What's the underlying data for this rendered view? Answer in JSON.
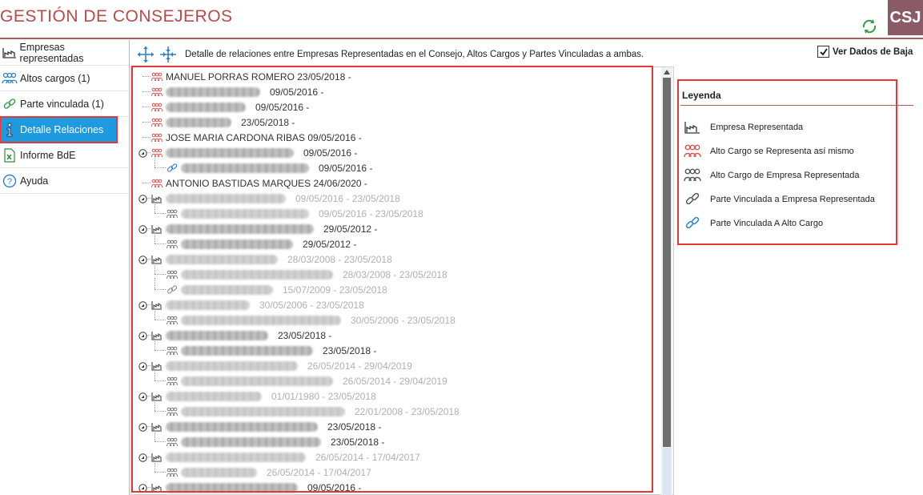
{
  "app": {
    "title": "GESTIÓN DE CONSEJEROS",
    "logo_text": "CSJ"
  },
  "sidebar": {
    "items": [
      {
        "label": "Empresas representadas",
        "icon": "factory-chart-icon",
        "active": false
      },
      {
        "label": "Altos cargos (1)",
        "icon": "people-group-icon",
        "active": false
      },
      {
        "label": "Parte vinculada (1)",
        "icon": "chain-link-icon",
        "active": false
      },
      {
        "label": "Detalle Relaciones",
        "icon": "info-icon",
        "active": true
      },
      {
        "label": "Informe BdE",
        "icon": "excel-file-icon",
        "active": false
      },
      {
        "label": "Ayuda",
        "icon": "help-icon",
        "active": false
      }
    ]
  },
  "toolbar": {
    "expand_all_icon": "expand-arrows-icon",
    "collapse_all_icon": "collapse-arrows-icon",
    "description": "Detalle de relaciones entre Empresas Representadas en el Consejo, Altos Cargos y Partes Vinculadas a ambas."
  },
  "ver_dados_baja": {
    "label": "Ver Dados de Baja",
    "checked": true
  },
  "tree": {
    "rows": [
      {
        "text": "MANUEL PORRAS ROMERO   23/05/2018 -"
      },
      {
        "text": "09/05/2016 -"
      },
      {
        "text": "09/05/2016 -"
      },
      {
        "text": "23/05/2018 -"
      },
      {
        "text": "JOSE MARIA CARDONA RIBAS   09/05/2016 -"
      },
      {
        "text": "09/05/2016 -"
      },
      {
        "text": "09/05/2016 -"
      },
      {
        "text": "ANTONIO BASTIDAS MARQUES   24/06/2020 -"
      },
      {
        "text": "09/05/2016 - 23/05/2018"
      },
      {
        "text": "09/05/2016 - 23/05/2018"
      },
      {
        "text": "29/05/2012 -"
      },
      {
        "text": "29/05/2012 -"
      },
      {
        "text": "28/03/2008 - 23/05/2018"
      },
      {
        "text": "28/03/2008 - 23/05/2018"
      },
      {
        "text": "15/07/2009 - 23/05/2018"
      },
      {
        "text": "30/05/2006 - 23/05/2018"
      },
      {
        "text": "30/05/2006 - 23/05/2018"
      },
      {
        "text": "23/05/2018 -"
      },
      {
        "text": "23/05/2018 -"
      },
      {
        "text": "26/05/2014 - 29/04/2019"
      },
      {
        "text": "26/05/2014 - 29/04/2019"
      },
      {
        "text": "01/01/1980 - 23/05/2018"
      },
      {
        "text": "22/01/2008 - 23/05/2018"
      },
      {
        "text": "23/05/2018 -"
      },
      {
        "text": "23/05/2018 -"
      },
      {
        "text": "26/05/2014 - 17/04/2017"
      },
      {
        "text": "26/05/2014 - 17/04/2017"
      },
      {
        "text": "09/05/2016 -"
      }
    ]
  },
  "legend": {
    "title": "Leyenda",
    "items": [
      {
        "label": "Empresa Representada",
        "icon": "factory-chart-icon"
      },
      {
        "label": "Alto Cargo se Representa así mismo",
        "icon": "people-red-icon"
      },
      {
        "label": "Alto Cargo de Empresa Representada",
        "icon": "people-gray-icon"
      },
      {
        "label": "Parte Vinculada a Empresa Representada",
        "icon": "chain-link-gray-icon"
      },
      {
        "label": "Parte Vinculada A Alto Cargo",
        "icon": "chain-link-blue-icon"
      }
    ]
  },
  "colors": {
    "brand_red": "#b94a4a",
    "active_blue": "#1e9ae0",
    "highlight_red": "#e53935",
    "logo_bg": "#8a5b67"
  }
}
